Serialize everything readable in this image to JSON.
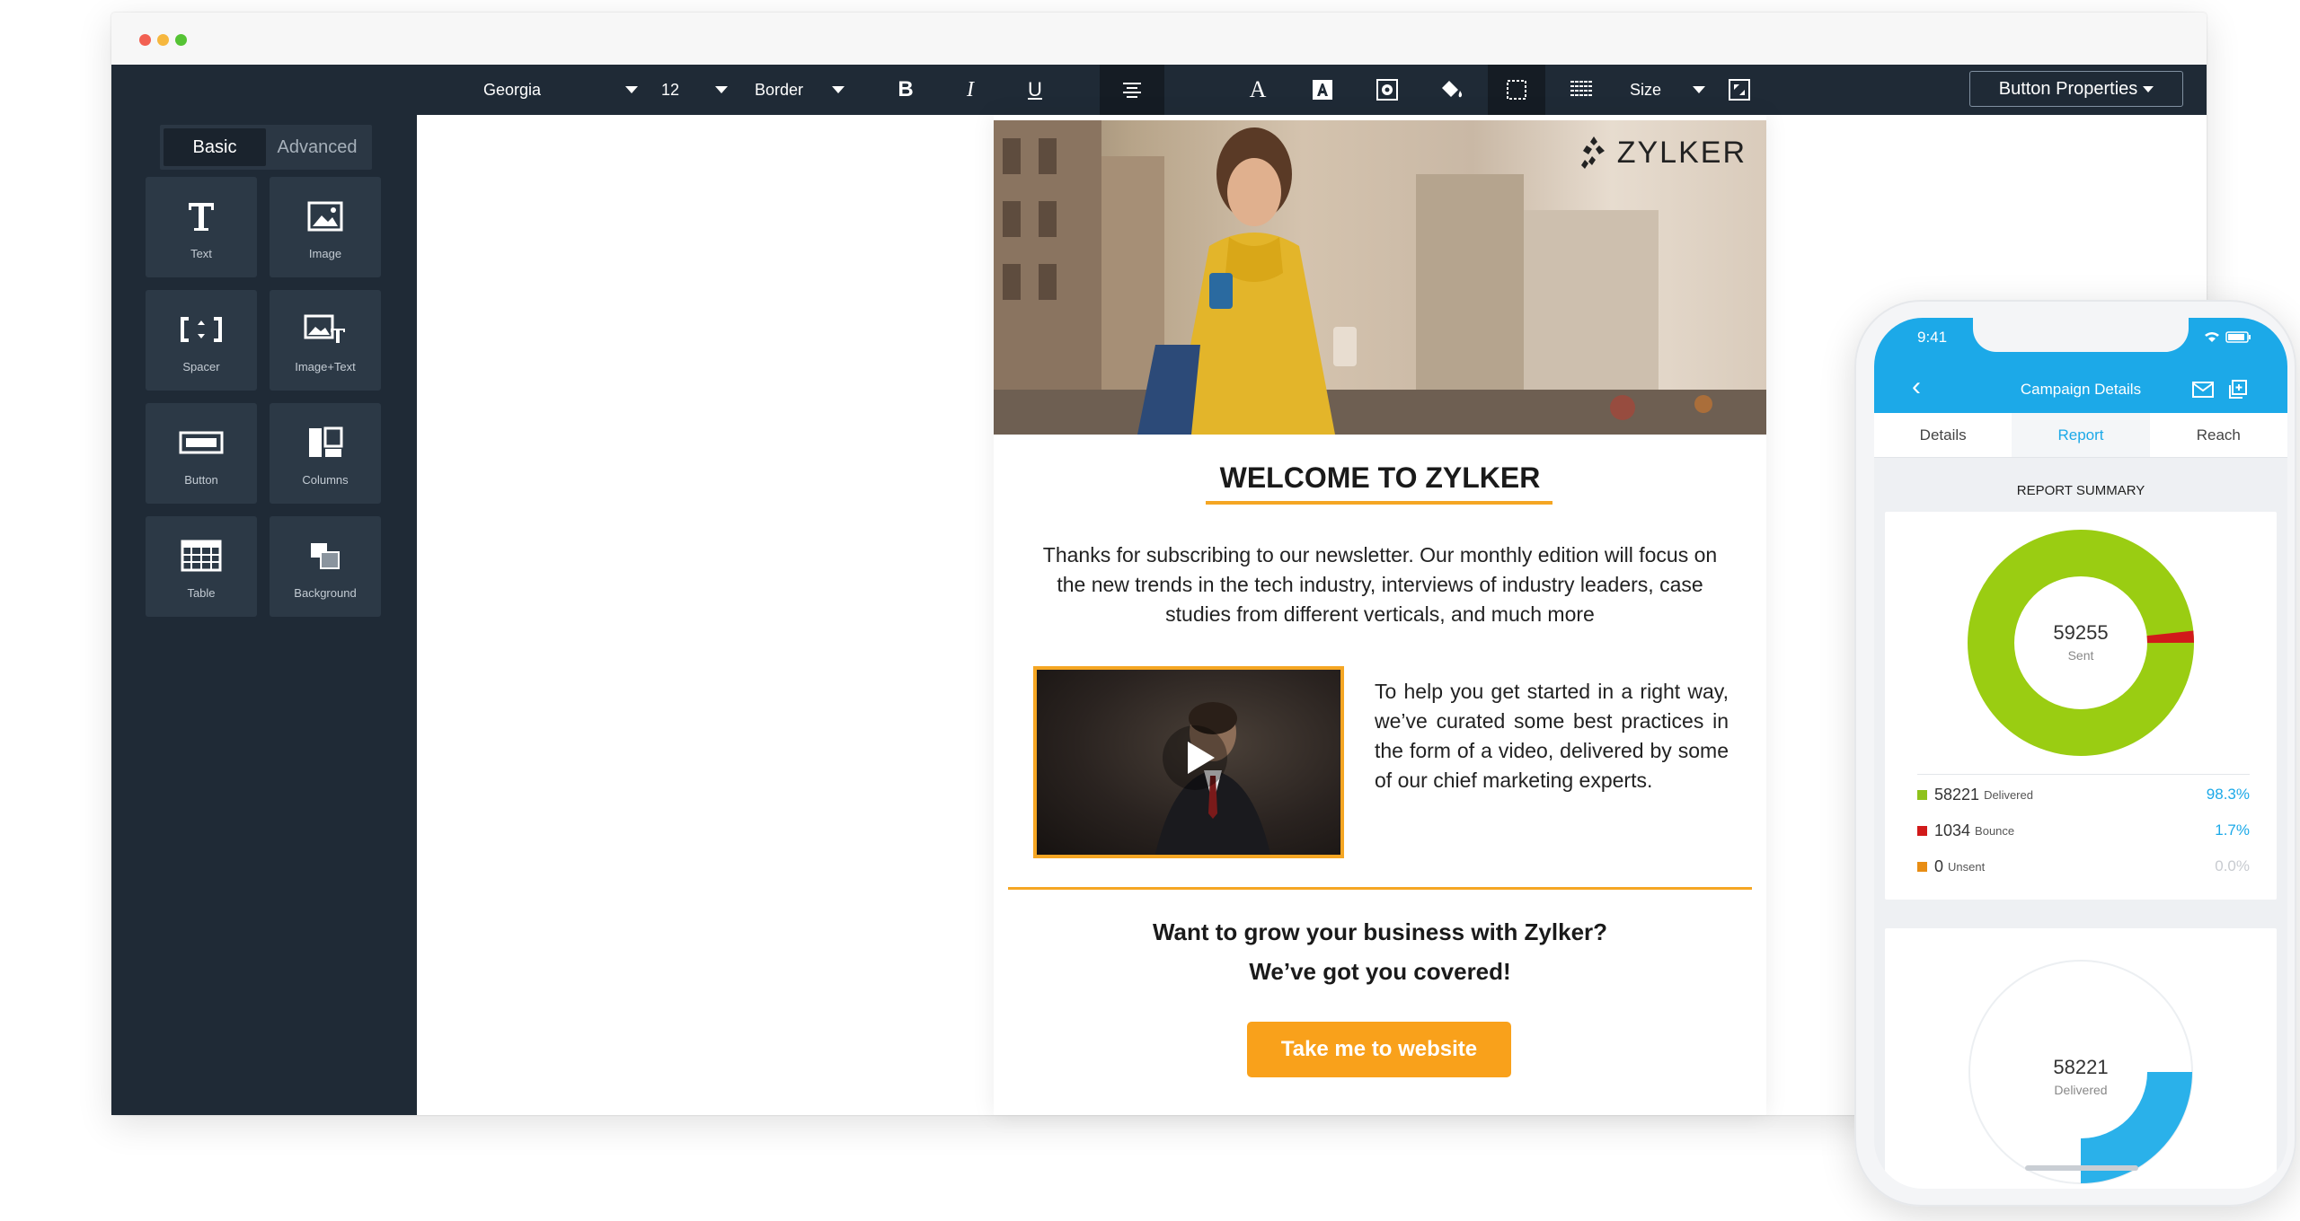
{
  "window": {
    "traffic_lights": [
      "close",
      "minimize",
      "maximize"
    ]
  },
  "sidebar": {
    "tabs": [
      {
        "label": "Basic",
        "active": true
      },
      {
        "label": "Advanced",
        "active": false
      }
    ],
    "tools": [
      {
        "label": "Text",
        "icon": "text-icon"
      },
      {
        "label": "Image",
        "icon": "image-icon"
      },
      {
        "label": "Spacer",
        "icon": "spacer-icon"
      },
      {
        "label": "Image+Text",
        "icon": "image-text-icon"
      },
      {
        "label": "Button",
        "icon": "button-icon"
      },
      {
        "label": "Columns",
        "icon": "columns-icon"
      },
      {
        "label": "Table",
        "icon": "table-icon"
      },
      {
        "label": "Background",
        "icon": "background-icon"
      }
    ]
  },
  "toolbar": {
    "font": "Georgia",
    "size": "12",
    "border": "Border",
    "size_label": "Size",
    "button_properties": "Button Properties",
    "icons": [
      "bold-icon",
      "italic-icon",
      "underline-icon",
      "align-center-icon",
      "font-color-icon",
      "highlight-icon",
      "image-settings-icon",
      "fill-color-icon",
      "border-box-icon",
      "line-spacing-icon",
      "resize-icon"
    ],
    "bold": "B",
    "italic": "I",
    "underline": "U",
    "font_color": "A"
  },
  "email": {
    "logo": "ZYLKER",
    "welcome": "WELCOME TO ZYLKER",
    "intro": "Thanks for subscribing to our newsletter. Our monthly edition will focus on the new trends in the tech industry, interviews of industry leaders, case studies from different verticals, and much more",
    "video_text": "To help you get started in a right way, we’ve curated some best practices in the form of a video, delivered by some of our chief marketing experts.",
    "grow_line1": "Want to grow your business with Zylker?",
    "grow_line2": "We’ve got you covered!",
    "cta": "Take me to website",
    "accent": "#f5a623"
  },
  "phone": {
    "time": "9:41",
    "title": "Campaign Details",
    "tabs": [
      {
        "label": "Details",
        "active": false
      },
      {
        "label": "Report",
        "active": true
      },
      {
        "label": "Reach",
        "active": false
      }
    ],
    "summary_title": "REPORT SUMMARY",
    "donut1": {
      "value": "59255",
      "label": "Sent",
      "colors": {
        "delivered": "#9acd12",
        "bounce": "#d11a1a"
      }
    },
    "stats": [
      {
        "value": "58221",
        "label": "Delivered",
        "pct": "98.3%",
        "color": "#8ec21b",
        "pct_color": "#1ca9e8"
      },
      {
        "value": "1034",
        "label": "Bounce",
        "pct": "1.7%",
        "color": "#d11a1a",
        "pct_color": "#1ca9e8"
      },
      {
        "value": "0",
        "label": "Unsent",
        "pct": "0.0%",
        "color": "#e88d14",
        "pct_color": "#c8cbd0"
      }
    ],
    "donut2": {
      "value": "58221",
      "label": "Delivered",
      "color": "#2ab1ea"
    },
    "header_color": "#1ca9e8"
  }
}
